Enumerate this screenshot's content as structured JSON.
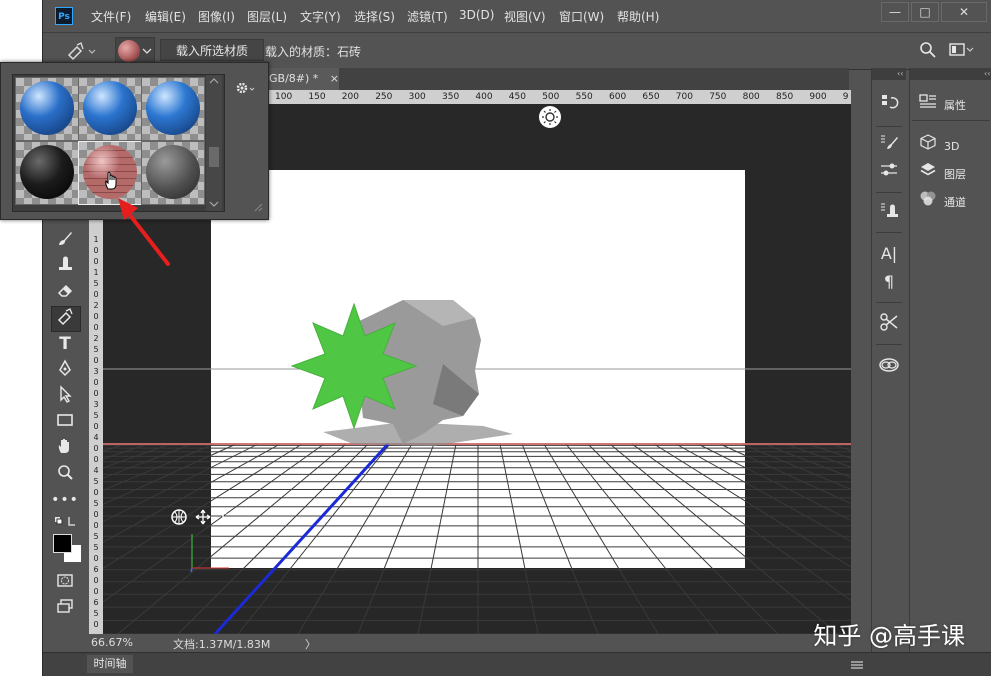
{
  "app": {
    "logo": "Ps"
  },
  "menu": [
    "文件(F)",
    "编辑(E)",
    "图像(I)",
    "图层(L)",
    "文字(Y)",
    "选择(S)",
    "滤镜(T)",
    "3D(D)",
    "视图(V)",
    "窗口(W)",
    "帮助(H)"
  ],
  "window_controls": {
    "minimize": "—",
    "maximize": "□",
    "close": "✕"
  },
  "options": {
    "load_button": "载入所选材质",
    "loaded_material_label": "载入的材质：石砖"
  },
  "document_tab": {
    "title": "GB/8#) *",
    "close": "×"
  },
  "ruler_top_ticks": [
    "100",
    "150",
    "200",
    "250",
    "300",
    "350",
    "400",
    "450",
    "500",
    "550",
    "600",
    "650",
    "700",
    "750",
    "800",
    "850",
    "900",
    "9"
  ],
  "ruler_left_ticks": [
    "1",
    "0",
    "0",
    "1",
    "5",
    "0",
    "2",
    "0",
    "0",
    "2",
    "5",
    "0",
    "3",
    "0",
    "0",
    "3",
    "5",
    "0",
    "4",
    "0",
    "0",
    "4",
    "5",
    "0",
    "5",
    "0",
    "0",
    "5",
    "5",
    "0",
    "6",
    "0",
    "0",
    "6",
    "5",
    "0"
  ],
  "status": {
    "zoom": "66.67%",
    "doc": "文档:1.37M/1.83M",
    "arrow": "〉"
  },
  "timeline": {
    "tab_label": "时间轴"
  },
  "panels": {
    "items": [
      {
        "label": "属性",
        "icon": "properties-icon"
      },
      {
        "label": "3D",
        "icon": "3d-cube-icon"
      },
      {
        "label": "图层",
        "icon": "layers-icon"
      },
      {
        "label": "通道",
        "icon": "channels-icon"
      }
    ]
  },
  "picker": {
    "materials": [
      {
        "name": "blue-glossy-1",
        "color": "#2a6fc9"
      },
      {
        "name": "blue-glossy-2",
        "color": "#2b74cf"
      },
      {
        "name": "blue-glossy-3",
        "color": "#2d78d2"
      },
      {
        "name": "black-glossy",
        "color": "#1c1c1c"
      },
      {
        "name": "stone-brick",
        "color": "#b56a6a"
      },
      {
        "name": "dark-stone",
        "color": "#4f4f4f"
      }
    ]
  },
  "watermark": "知乎 @高手课"
}
